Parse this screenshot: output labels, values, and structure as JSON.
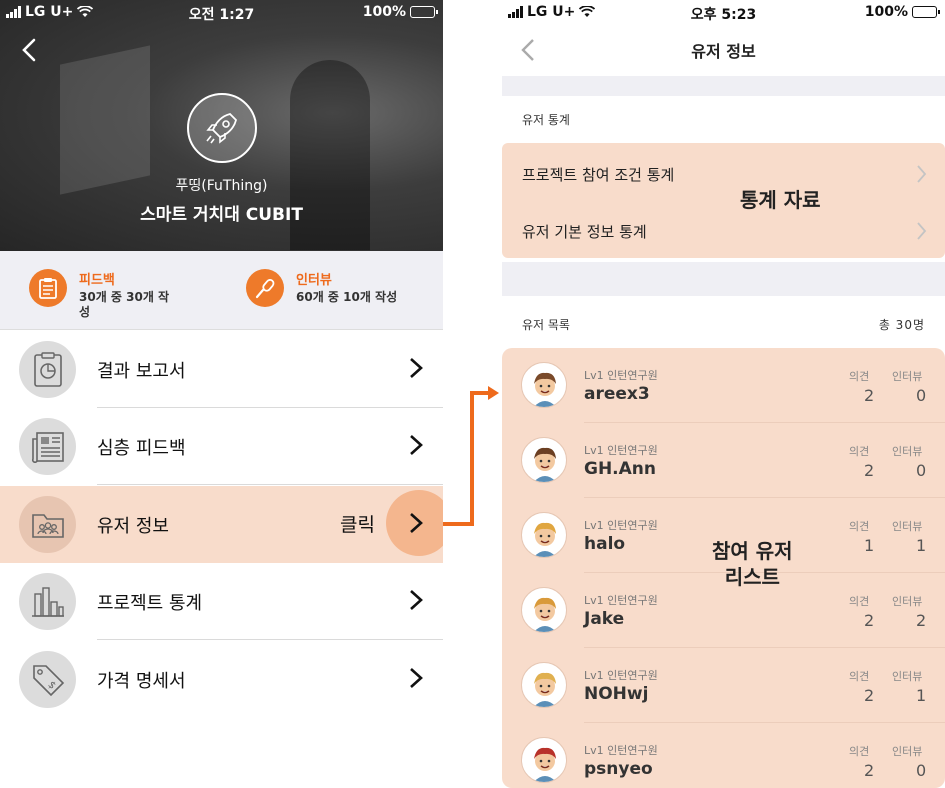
{
  "left": {
    "status": {
      "carrier": "LG U+",
      "time": "오전 1:27",
      "battery": "100%"
    },
    "project": {
      "subtitle": "푸띵(FuThing)",
      "title": "스마트 거치대 CUBIT"
    },
    "stats": [
      {
        "title": "피드백",
        "desc": "30개 중 30개 작성",
        "icon": "clipboard-icon"
      },
      {
        "title": "인터뷰",
        "desc": "60개 중 10개 작성",
        "icon": "microphone-icon"
      }
    ],
    "menu": [
      {
        "label": "결과 보고서",
        "icon": "report-icon"
      },
      {
        "label": "심층 피드백",
        "icon": "newspaper-icon"
      },
      {
        "label": "유저 정보",
        "icon": "users-folder-icon"
      },
      {
        "label": "프로젝트 통계",
        "icon": "bar-chart-icon"
      },
      {
        "label": "가격 명세서",
        "icon": "price-tag-icon"
      }
    ],
    "click_annotation": "클릭"
  },
  "right": {
    "status": {
      "carrier": "LG U+",
      "time": "오후 5:23",
      "battery": "100%"
    },
    "nav_title": "유저 정보",
    "stats_section_label": "유저 통계",
    "stats_items": [
      "프로젝트 참여 조건 통계",
      "유저 기본 정보 통계"
    ],
    "stats_annotation": "통계 자료",
    "list_section_label": "유저 목록",
    "list_count": "총 30명",
    "list_annotation_line1": "참여 유저",
    "list_annotation_line2": "리스트",
    "col_opinion": "의견",
    "col_interview": "인터뷰",
    "users": [
      {
        "level": "Lv1 인턴연구원",
        "name": "areex3",
        "opinions": "2",
        "interviews": "0"
      },
      {
        "level": "Lv1 인턴연구원",
        "name": "GH.Ann",
        "opinions": "2",
        "interviews": "0"
      },
      {
        "level": "Lv1 인턴연구원",
        "name": "halo",
        "opinions": "1",
        "interviews": "1"
      },
      {
        "level": "Lv1 인턴연구원",
        "name": "Jake",
        "opinions": "2",
        "interviews": "2"
      },
      {
        "level": "Lv1 인턴연구원",
        "name": "NOHwj",
        "opinions": "2",
        "interviews": "1"
      },
      {
        "level": "Lv1 인턴연구원",
        "name": "psnyeo",
        "opinions": "2",
        "interviews": "0"
      }
    ]
  },
  "colors": {
    "accent_orange": "#ee7a2a",
    "highlight": "#f8dccb",
    "arrow": "#ee6a1c"
  }
}
